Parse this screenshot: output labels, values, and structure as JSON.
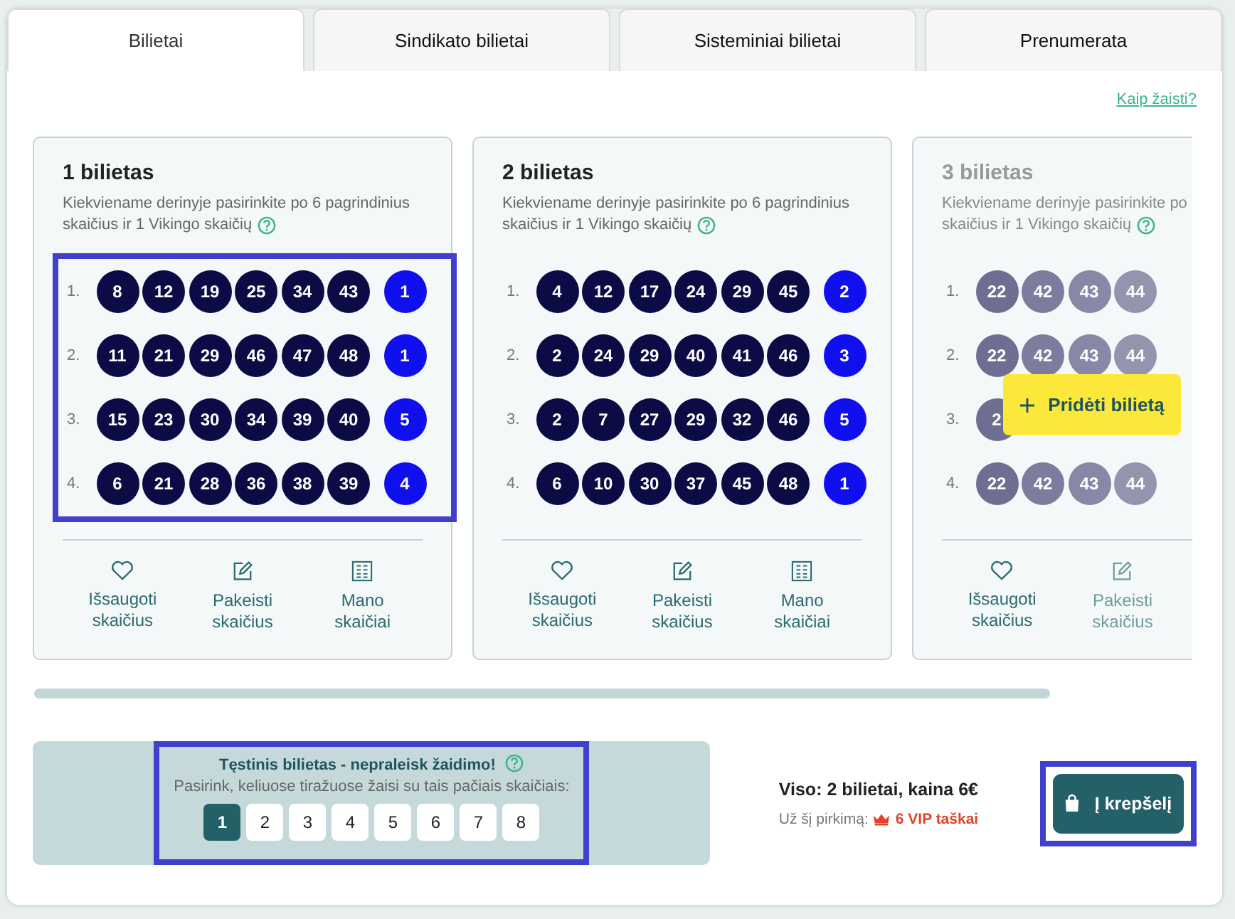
{
  "tabs": [
    {
      "label": "Bilietai",
      "selected": true
    },
    {
      "label": "Sindikato bilietai",
      "selected": false
    },
    {
      "label": "Sisteminiai bilietai",
      "selected": false
    },
    {
      "label": "Prenumerata",
      "selected": false
    }
  ],
  "help_link": "Kaip žaisti?",
  "tickets": [
    {
      "title": "1 bilietas",
      "description_lines": [
        "Kiekviename derinyje pasirinkite po 6 pagrindinius",
        "skaičius ir 1 Vikingo skaičių"
      ],
      "highlighted": true,
      "faded": false,
      "rows": [
        {
          "label": "1.",
          "numbers": [
            "8",
            "12",
            "19",
            "25",
            "34",
            "43"
          ],
          "viking": "1"
        },
        {
          "label": "2.",
          "numbers": [
            "11",
            "21",
            "29",
            "46",
            "47",
            "48"
          ],
          "viking": "1"
        },
        {
          "label": "3.",
          "numbers": [
            "15",
            "23",
            "30",
            "34",
            "39",
            "40"
          ],
          "viking": "5"
        },
        {
          "label": "4.",
          "numbers": [
            "6",
            "21",
            "28",
            "36",
            "38",
            "39"
          ],
          "viking": "4"
        }
      ],
      "actions": [
        {
          "kind": "heart",
          "label": "Išsaugoti skaičius"
        },
        {
          "kind": "edit",
          "label": "Pakeisti skaičius"
        },
        {
          "kind": "numbers",
          "label": "Mano skaičiai"
        }
      ]
    },
    {
      "title": "2 bilietas",
      "description_lines": [
        "Kiekviename derinyje pasirinkite po 6 pagrindinius",
        "skaičius ir 1 Vikingo skaičių"
      ],
      "highlighted": false,
      "faded": false,
      "rows": [
        {
          "label": "1.",
          "numbers": [
            "4",
            "12",
            "17",
            "24",
            "29",
            "45"
          ],
          "viking": "2"
        },
        {
          "label": "2.",
          "numbers": [
            "2",
            "24",
            "29",
            "40",
            "41",
            "46"
          ],
          "viking": "3"
        },
        {
          "label": "3.",
          "numbers": [
            "2",
            "7",
            "27",
            "29",
            "32",
            "46"
          ],
          "viking": "5"
        },
        {
          "label": "4.",
          "numbers": [
            "6",
            "10",
            "30",
            "37",
            "45",
            "48"
          ],
          "viking": "1"
        }
      ],
      "actions": [
        {
          "kind": "heart",
          "label": "Išsaugoti skaičius"
        },
        {
          "kind": "edit",
          "label": "Pakeisti skaičius"
        },
        {
          "kind": "numbers",
          "label": "Mano skaičiai"
        }
      ]
    },
    {
      "title": "3 bilietas",
      "description_lines": [
        "Kiekviename derinyje pasirinkite po",
        "skaičius ir 1 Vikingo skaičių"
      ],
      "highlighted": false,
      "faded": true,
      "rows": [
        {
          "label": "1.",
          "numbers": [
            "22",
            "42",
            "43",
            "44"
          ]
        },
        {
          "label": "2.",
          "numbers": [
            "22",
            "42",
            "43",
            "44"
          ]
        },
        {
          "label": "3.",
          "numbers": [
            "2"
          ]
        },
        {
          "label": "4.",
          "numbers": [
            "22",
            "42",
            "43",
            "44"
          ]
        }
      ],
      "actions": [
        {
          "kind": "heart",
          "label": "Išsaugoti skaičius"
        },
        {
          "kind": "edit",
          "label": "Pakeisti skaičius"
        }
      ]
    }
  ],
  "add_ticket_button": "Pridėti bilietą",
  "continuation": {
    "title": "Tęstinis bilietas - nepraleisk žaidimo!",
    "subtitle": "Pasirink, keliuose tiražuose žaisi su tais pačiais skaičiais:",
    "highlighted": true,
    "options": [
      {
        "label": "1",
        "selected": true
      },
      {
        "label": "2",
        "selected": false
      },
      {
        "label": "3",
        "selected": false
      },
      {
        "label": "4",
        "selected": false
      },
      {
        "label": "5",
        "selected": false
      },
      {
        "label": "6",
        "selected": false
      },
      {
        "label": "7",
        "selected": false
      },
      {
        "label": "8",
        "selected": false
      }
    ]
  },
  "summary": {
    "total": "Viso: 2 bilietai, kaina 6€",
    "points_label": "Už šį pirkimą:",
    "points": "6 VIP taškai"
  },
  "cart_button": {
    "label": "Į krepšelį",
    "highlighted": true
  }
}
